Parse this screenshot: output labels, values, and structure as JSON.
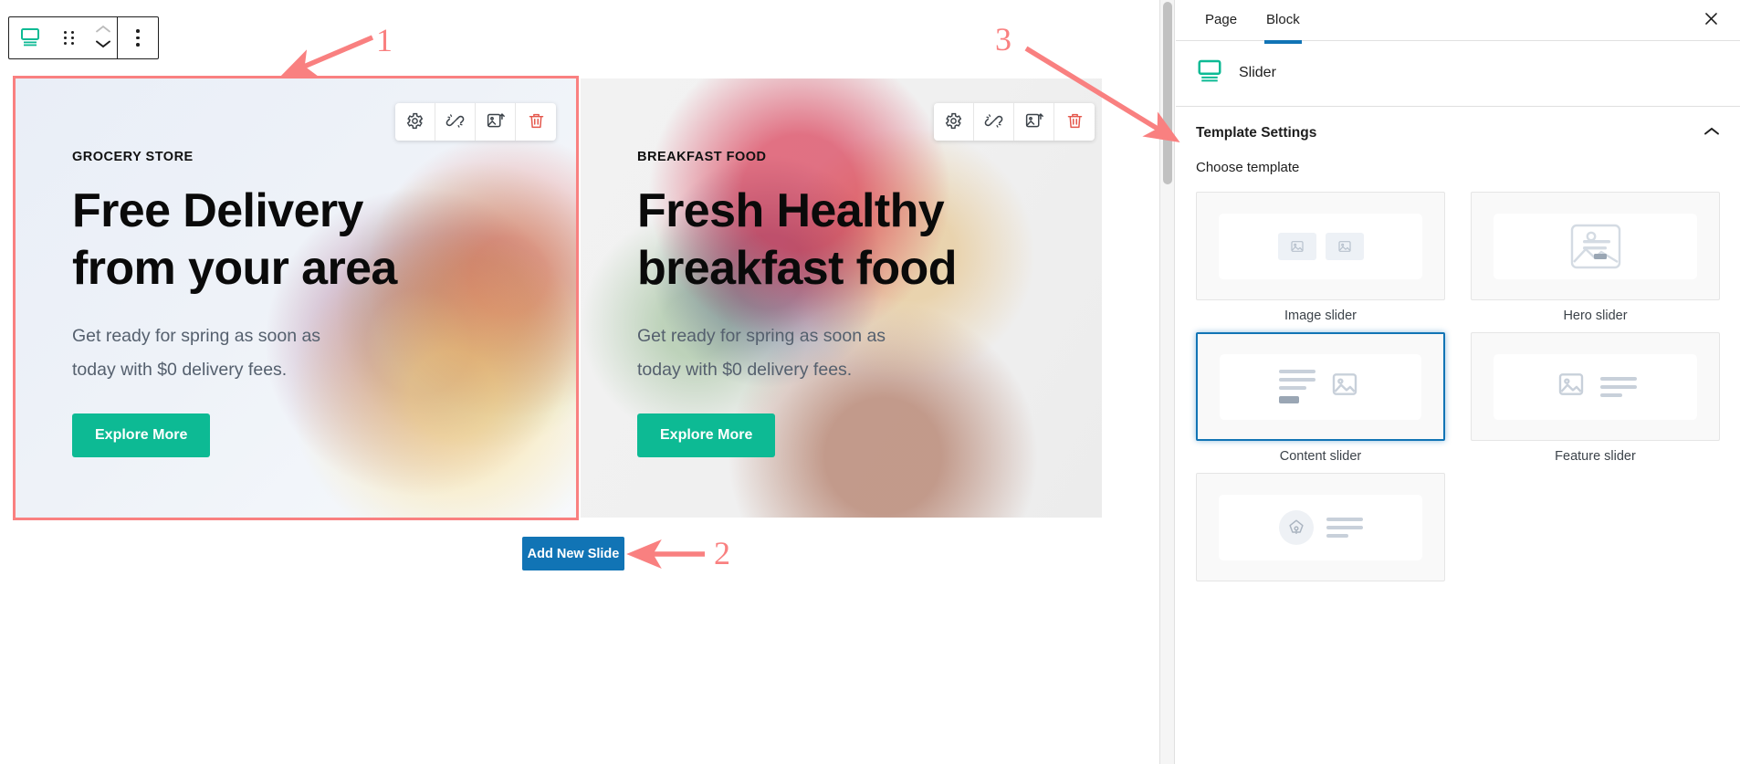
{
  "editor": {
    "block_toolbar": {
      "slider_block_icon": "slider-block-icon",
      "drag_handle_icon": "drag-handle-icon",
      "move_up_icon": "chevron-up-icon",
      "move_down_icon": "chevron-down-icon",
      "more_options_icon": "more-options-vertical-icon"
    },
    "slide_tools": [
      {
        "icon": "gear-icon",
        "label": "Settings"
      },
      {
        "icon": "broken-link-icon",
        "label": "Unlink"
      },
      {
        "icon": "image-upload-icon",
        "label": "Replace image"
      },
      {
        "icon": "trash-icon",
        "label": "Delete"
      }
    ],
    "add_slide_button": "Add New Slide"
  },
  "slides": [
    {
      "eyebrow": "GROCERY STORE",
      "headline": "Free Delivery\nfrom your area",
      "subtext": "Get ready for spring as soon as\ntoday with $0 delivery fees.",
      "cta": "Explore More",
      "selected": true
    },
    {
      "eyebrow": "BREAKFAST FOOD",
      "headline": "Fresh Healthy\nbreakfast food",
      "subtext": "Get ready for spring as soon as\ntoday with $0 delivery fees.",
      "cta": "Explore More",
      "selected": false
    }
  ],
  "annotations": [
    {
      "number": "1",
      "target": "selected-slide"
    },
    {
      "number": "2",
      "target": "add-new-slide-button"
    },
    {
      "number": "3",
      "target": "template-settings-panel"
    }
  ],
  "sidebar": {
    "tabs": [
      {
        "label": "Page",
        "active": false
      },
      {
        "label": "Block",
        "active": true
      }
    ],
    "close_icon": "close-icon",
    "block": {
      "icon": "slider-block-icon",
      "name": "Slider"
    },
    "panel": {
      "title": "Template Settings",
      "collapse_icon": "chevron-up-icon",
      "choose_label": "Choose template",
      "templates": [
        {
          "name": "Image slider",
          "thumb": "two-image-placeholders",
          "selected": false
        },
        {
          "name": "Hero slider",
          "thumb": "image-with-overlay-text",
          "selected": false
        },
        {
          "name": "Content slider",
          "thumb": "text-left-image-right",
          "selected": true
        },
        {
          "name": "Feature slider",
          "thumb": "image-left-text-right",
          "selected": false
        },
        {
          "name": "",
          "thumb": "pen-tool-left-text-right",
          "selected": false
        }
      ]
    }
  },
  "colors": {
    "cta_green": "#0dba94",
    "primary_blue": "#1174b5",
    "annotation_red": "#f98080",
    "trash_red": "#e4574c"
  }
}
